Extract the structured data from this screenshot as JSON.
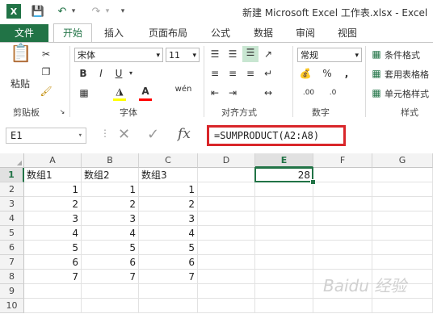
{
  "window": {
    "title": "新建 Microsoft Excel 工作表.xlsx - Excel"
  },
  "quick_access": {
    "icons": [
      "excel-logo-icon",
      "save-icon",
      "undo-icon",
      "redo-icon",
      "customize-icon"
    ]
  },
  "tabs": [
    "文件",
    "开始",
    "插入",
    "页面布局",
    "公式",
    "数据",
    "审阅",
    "视图"
  ],
  "active_tab": "开始",
  "ribbon": {
    "clipboard": {
      "paste_label": "粘贴",
      "group_label": "剪贴板"
    },
    "font": {
      "font_name": "宋体",
      "font_size": "11",
      "bold": "B",
      "italic": "I",
      "underline": "U",
      "font_color_letter": "A",
      "phonetic": "wén",
      "group_label": "字体",
      "font_color": "#ff0000",
      "fill_color": "#ffff00"
    },
    "alignment": {
      "group_label": "对齐方式"
    },
    "number": {
      "format": "常规",
      "percent": "%",
      "comma": ",",
      "group_label": "数字"
    },
    "styles": {
      "conditional": "条件格式",
      "table": "套用表格格",
      "cell": "单元格样式",
      "group_label": "样式"
    }
  },
  "formula_bar": {
    "name_box": "E1",
    "fx": "fx",
    "formula": "=SUMPRODUCT(A2:A8)",
    "highlight_color": "#d9262a"
  },
  "sheet": {
    "columns": [
      "A",
      "B",
      "C",
      "D",
      "E",
      "F",
      "G"
    ],
    "rows": [
      "1",
      "2",
      "3",
      "4",
      "5",
      "6",
      "7",
      "8",
      "9",
      "10"
    ],
    "selected_cell": "E1",
    "cells": {
      "A1": "数组1",
      "B1": "数组2",
      "C1": "数组3",
      "E1": "28",
      "A2": "1",
      "B2": "1",
      "C2": "1",
      "A3": "2",
      "B3": "2",
      "C3": "2",
      "A4": "3",
      "B4": "3",
      "C4": "3",
      "A5": "4",
      "B5": "4",
      "C5": "4",
      "A6": "5",
      "B6": "5",
      "C6": "5",
      "A7": "6",
      "B7": "6",
      "C7": "6",
      "A8": "7",
      "B8": "7",
      "C8": "7"
    },
    "accent_color": "#217346"
  },
  "watermark": "Baidu 经验"
}
